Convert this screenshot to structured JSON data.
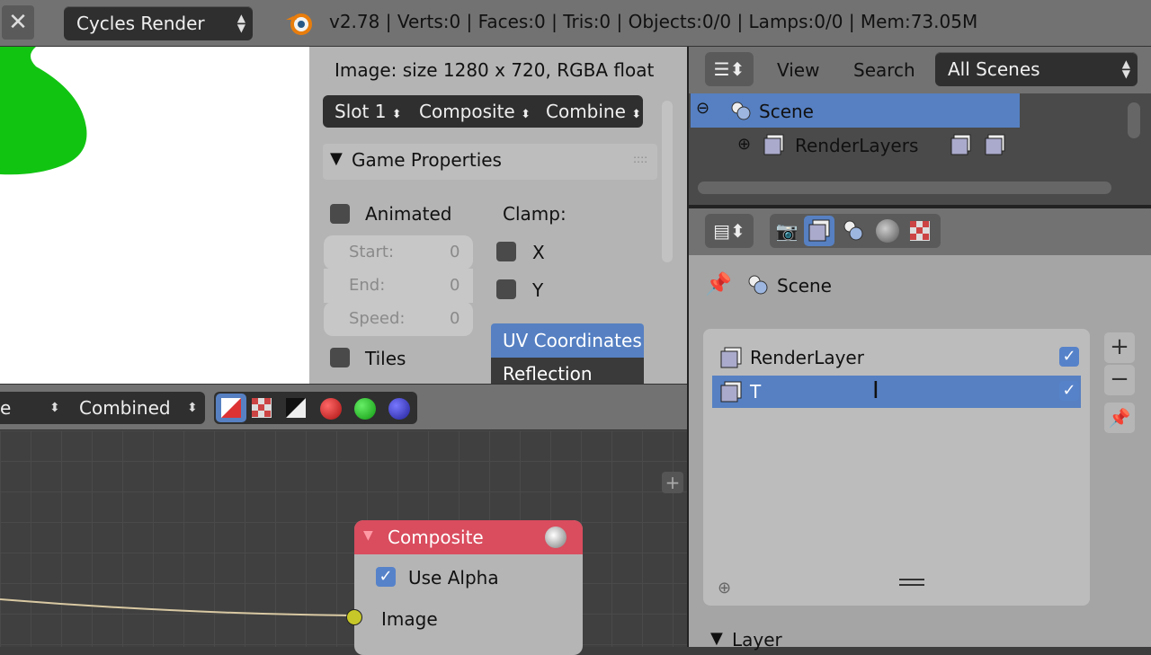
{
  "topbar": {
    "render_engine": "Cycles Render",
    "stats": "v2.78 | Verts:0 | Faces:0 | Tris:0 | Objects:0/0 | Lamps:0/0 | Mem:73.05M"
  },
  "image_panel": {
    "image_info": "Image: size 1280 x 720, RGBA float",
    "slot": "Slot 1",
    "composite": "Composite",
    "combine": "Combine",
    "game_properties": "Game Properties",
    "animated": "Animated",
    "clamp": "Clamp:",
    "start": "Start:",
    "start_val": "0",
    "end": "End:",
    "end_val": "0",
    "speed": "Speed:",
    "speed_val": "0",
    "x": "X",
    "y": "Y",
    "tiles": "Tiles",
    "uv_coordinates": "UV Coordinates",
    "reflection": "Reflection"
  },
  "image_header": {
    "partial": "e",
    "combined": "Combined"
  },
  "node": {
    "title": "Composite",
    "use_alpha": "Use Alpha",
    "image": "Image"
  },
  "outliner": {
    "view": "View",
    "search": "Search",
    "all_scenes": "All Scenes",
    "scene": "Scene",
    "render_layers": "RenderLayers"
  },
  "properties": {
    "scene": "Scene",
    "layers": [
      {
        "name": "RenderLayer"
      },
      {
        "name": "T"
      }
    ],
    "layer_section": "Layer"
  },
  "colors": {
    "selection": "#5680c2",
    "node_header": "#d94d5e",
    "socket": "#c7c729"
  }
}
